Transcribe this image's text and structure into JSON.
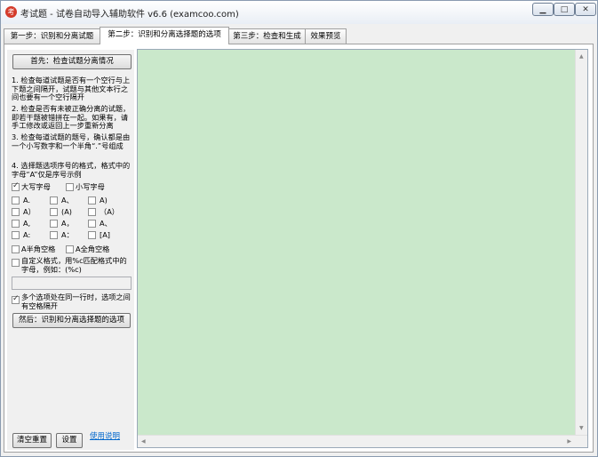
{
  "window": {
    "title": "考试题 - 试卷自动导入辅助软件 v6.6 (examcoo.com)",
    "min_glyph": "▁",
    "max_glyph": "□",
    "close_glyph": "✕"
  },
  "tabs": [
    {
      "label": "第一步：识别和分离试题"
    },
    {
      "label": "第二步：识别和分离选择题的选项"
    },
    {
      "label": "第三步：检查和生成"
    },
    {
      "label": "效果预览"
    }
  ],
  "left": {
    "check_button": "首先：检查试题分离情况",
    "instructions": [
      "1. 检查每道试题是否有一个空行与上下题之间隔开，试题与其他文本行之间也要有一个空行隔开",
      "2. 检查是否有未被正确分离的试题，即若干题被错拼在一起。如果有，请手工修改或返回上一步重新分离",
      "3. 检查每道试题的题号，确认都是由一个小写数字和一个半角“.”号组成",
      "4. 选择题选项序号的格式，格式中的字母“A”仅是序号示例"
    ],
    "case_options": [
      {
        "label": "大写字母",
        "checked": true
      },
      {
        "label": "小写字母",
        "checked": false
      }
    ],
    "format_options": [
      {
        "label": "A.",
        "checked": false
      },
      {
        "label": "A、",
        "checked": false
      },
      {
        "label": "A)",
        "checked": false
      },
      {
        "label": "A）",
        "checked": false
      },
      {
        "label": "(A)",
        "checked": false
      },
      {
        "label": "（A）",
        "checked": false
      },
      {
        "label": "A,",
        "checked": false
      },
      {
        "label": "A，",
        "checked": false
      },
      {
        "label": "A、",
        "checked": false
      },
      {
        "label": "A:",
        "checked": false
      },
      {
        "label": "A：",
        "checked": false
      },
      {
        "label": "[A]",
        "checked": false
      }
    ],
    "space_options": [
      {
        "label": "A半角空格",
        "checked": false
      },
      {
        "label": "A全角空格",
        "checked": false
      }
    ],
    "custom_format_label": "自定义格式，用%c匹配格式中的字母，例如：(%c)",
    "custom_format_value": "",
    "multi_option_label": "多个选项处在同一行时，选项之间有空格隔开",
    "multi_option_checked": true,
    "identify_button": "然后：识别和分离选择题的选项",
    "clear_button": "清空重置",
    "settings_button": "设置",
    "help_link": "使用说明"
  },
  "editor": {
    "content": ""
  }
}
